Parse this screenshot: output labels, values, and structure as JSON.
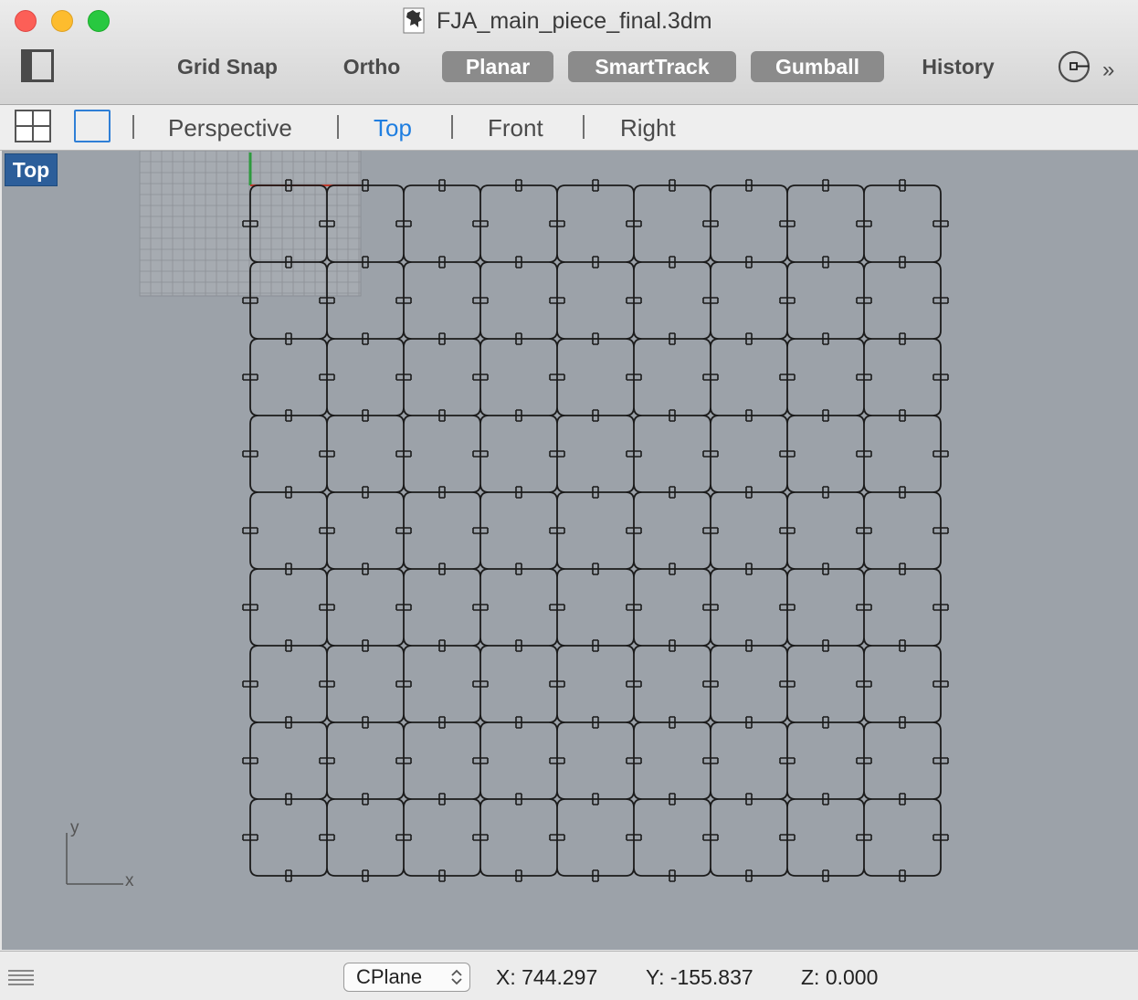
{
  "window": {
    "title": "FJA_main_piece_final.3dm",
    "traffic_colors": {
      "close": "#fc5f57",
      "minimize": "#fdbc2e",
      "maximize": "#28c840"
    }
  },
  "toolbar": {
    "grid_snap": {
      "label": "Grid Snap",
      "active": false
    },
    "ortho": {
      "label": "Ortho",
      "active": false
    },
    "planar": {
      "label": "Planar",
      "active": true
    },
    "smarttrack": {
      "label": "SmartTrack",
      "active": true
    },
    "gumball": {
      "label": "Gumball",
      "active": true
    },
    "history": {
      "label": "History",
      "active": false
    },
    "overflow": "»"
  },
  "viewport_tabs": {
    "perspective": "Perspective",
    "top": "Top",
    "front": "Front",
    "right": "Right",
    "active": "Top"
  },
  "viewport": {
    "label": "Top",
    "background_color": "#9ca2a9",
    "label_color": "#2c5e9a",
    "piece_grid": {
      "columns": 9,
      "rows": 9
    },
    "axis_labels": {
      "x": "x",
      "y": "y"
    }
  },
  "statusbar": {
    "cplane": "CPlane",
    "x": "X: 744.297",
    "y": "Y: -155.837",
    "z": "Z: 0.000"
  },
  "colors": {
    "accent": "#1f7ee0",
    "toggle_on": "#8b8b8b",
    "x_axis": "#c0392b",
    "y_axis": "#2e9a3e"
  }
}
